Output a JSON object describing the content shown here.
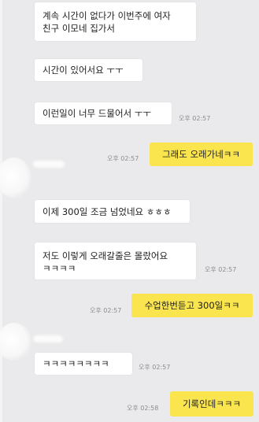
{
  "messages": [
    {
      "side": "in",
      "text": "계속 시간이 없다가 이번주에 여자\n친구 이모네 집가서",
      "time": ""
    },
    {
      "side": "in",
      "text": "시간이 있어서요 ㅜㅜ",
      "time": ""
    },
    {
      "side": "in",
      "text": "이런일이 너무 드물어서 ㅜㅜ",
      "time": "오후 02:57"
    },
    {
      "side": "out",
      "text": "그래도 오래가네ㅋㅋ",
      "time": "오후 02:57"
    },
    {
      "side": "in",
      "text": "이제 300일 조금 넘었네요 ㅎㅎㅎ",
      "time": ""
    },
    {
      "side": "in",
      "text": "저도 이렇게 오래갈줄은 몰랐어요\nㅋㅋㅋㅋ",
      "time": "오후 02:57"
    },
    {
      "side": "out",
      "text": "수업한번듣고 300일ㅋㅋ",
      "time": "오후 02:57"
    },
    {
      "side": "in",
      "text": "ㅋㅋㅋㅋㅋㅋㅋㅋ",
      "time": "오후 02:57"
    },
    {
      "side": "out",
      "text": "기록인데ㅋㅋㅋ",
      "time": "오후 02:58"
    }
  ],
  "colors": {
    "background": "#eaeaec",
    "incoming_bubble": "#ffffff",
    "outgoing_bubble": "#fbe54e"
  }
}
